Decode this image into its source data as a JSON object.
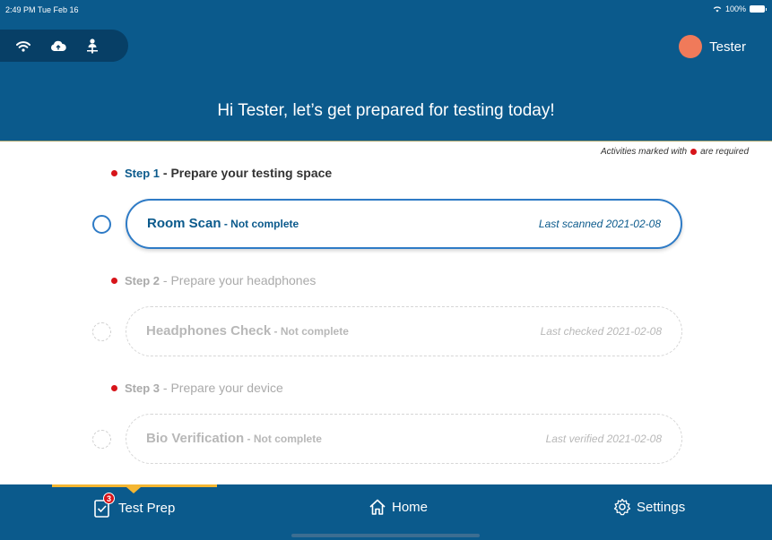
{
  "status_bar": {
    "time": "2:49 PM  Tue Feb 16",
    "battery": "100%"
  },
  "header": {
    "connection_icons": [
      "wifi-icon",
      "cloud-upload-icon",
      "person-network-icon"
    ],
    "user_name": "Tester",
    "avatar_color": "#f07a5a",
    "greeting": "Hi Tester, let’s get prepared for testing today!"
  },
  "legend": {
    "before": "Activities marked with",
    "after": "are required"
  },
  "steps": [
    {
      "number": "Step 1",
      "title": " - Prepare your testing space",
      "state": "active",
      "card": {
        "title": "Room Scan",
        "status": " - Not complete",
        "date": "Last scanned 2021-02-08"
      }
    },
    {
      "number": "Step 2",
      "title": " - Prepare your headphones",
      "state": "inactive",
      "card": {
        "title": "Headphones Check",
        "status": " - Not complete",
        "date": "Last checked 2021-02-08"
      }
    },
    {
      "number": "Step 3",
      "title": " - Prepare your device",
      "state": "inactive",
      "card": {
        "title": "Bio Verification",
        "status": " - Not complete",
        "date": "Last verified 2021-02-08"
      }
    }
  ],
  "tabbar": {
    "test_prep": {
      "label": "Test Prep",
      "badge": "3",
      "icon": "clipboard-check-icon"
    },
    "home": {
      "label": "Home",
      "icon": "home-icon"
    },
    "settings": {
      "label": "Settings",
      "icon": "gear-icon"
    }
  },
  "colors": {
    "primary": "#0b5a8c",
    "accent": "#2e7bc6",
    "required": "#d7141a",
    "tab_indicator": "#f4b632"
  }
}
